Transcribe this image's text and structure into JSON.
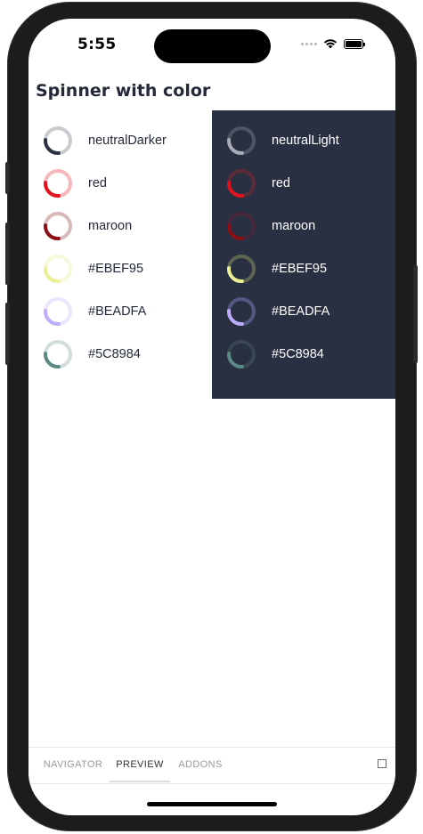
{
  "status_bar": {
    "time": "5:55",
    "icons": [
      "signal-dots-icon",
      "wifi-icon",
      "battery-icon"
    ]
  },
  "page": {
    "title": "Spinner with color"
  },
  "light_panel": {
    "background": "#ffffff",
    "items": [
      {
        "label": "neutralDarker",
        "track": "#c9cbcf",
        "arc": "#2b3242"
      },
      {
        "label": "red",
        "track": "#f7b7bb",
        "arc": "#e5121f"
      },
      {
        "label": "maroon",
        "track": "#d8b9b9",
        "arc": "#8b0f14"
      },
      {
        "label": "#EBEF95",
        "track": "#f7f8d9",
        "arc": "#ebef95"
      },
      {
        "label": "#BEADFA",
        "track": "#ebe6fd",
        "arc": "#beadfa"
      },
      {
        "label": "#5C8984",
        "track": "#d3dedc",
        "arc": "#5c8984"
      }
    ]
  },
  "dark_panel": {
    "background": "#283042",
    "items": [
      {
        "label": "neutralLight",
        "track": "#4e5565",
        "arc": "#a7abb3"
      },
      {
        "label": "red",
        "track": "#5c2a38",
        "arc": "#e5121f"
      },
      {
        "label": "maroon",
        "track": "#46283a",
        "arc": "#8b0f14"
      },
      {
        "label": "#EBEF95",
        "track": "#5e6452",
        "arc": "#ebef95"
      },
      {
        "label": "#BEADFA",
        "track": "#525a82",
        "arc": "#beadfa"
      },
      {
        "label": "#5C8984",
        "track": "#384650",
        "arc": "#5c8984"
      }
    ]
  },
  "tab_bar": {
    "tabs": [
      {
        "label": "NAVIGATOR",
        "active": false
      },
      {
        "label": "PREVIEW",
        "active": true
      },
      {
        "label": "ADDONS",
        "active": false
      }
    ],
    "right_icon": "square-icon"
  }
}
